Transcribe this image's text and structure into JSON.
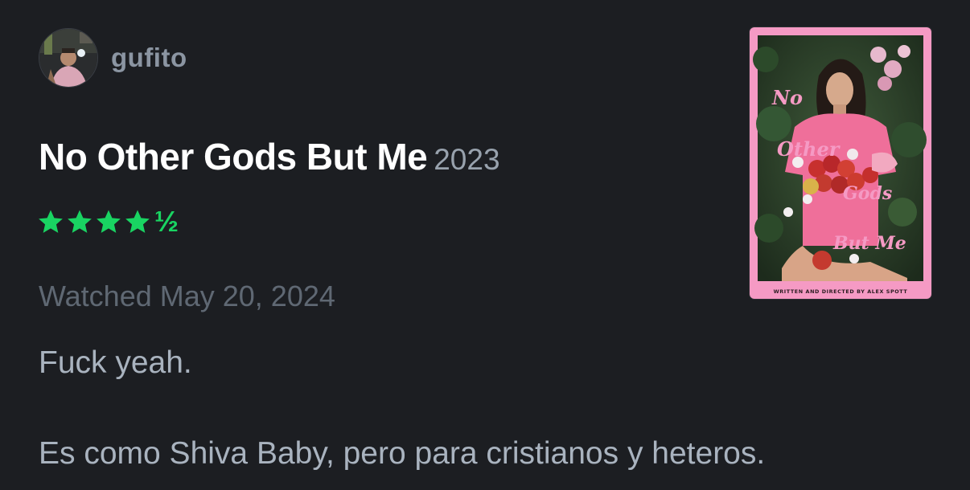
{
  "author": {
    "name": "gufito"
  },
  "film": {
    "title": "No Other Gods But Me",
    "year": "2023"
  },
  "rating": {
    "stars": 4.5,
    "max": 5,
    "half_glyph": "½",
    "color": "#19d462"
  },
  "watched": {
    "label": "Watched",
    "date": "May 20, 2024"
  },
  "review": {
    "lines": [
      "Fuck yeah.",
      "Es como Shiva Baby, pero para cristianos y heteros."
    ]
  },
  "poster": {
    "title_words": [
      "No",
      "Other",
      "Gods",
      "But Me"
    ],
    "credit": "WRITTEN AND DIRECTED BY ALEX SPOTT",
    "accent": "#f59ac4"
  },
  "theme": {
    "background": "#1c1e22",
    "title_color": "#ffffff",
    "muted_color": "#5f6873",
    "text_color": "#a9b3bf"
  }
}
